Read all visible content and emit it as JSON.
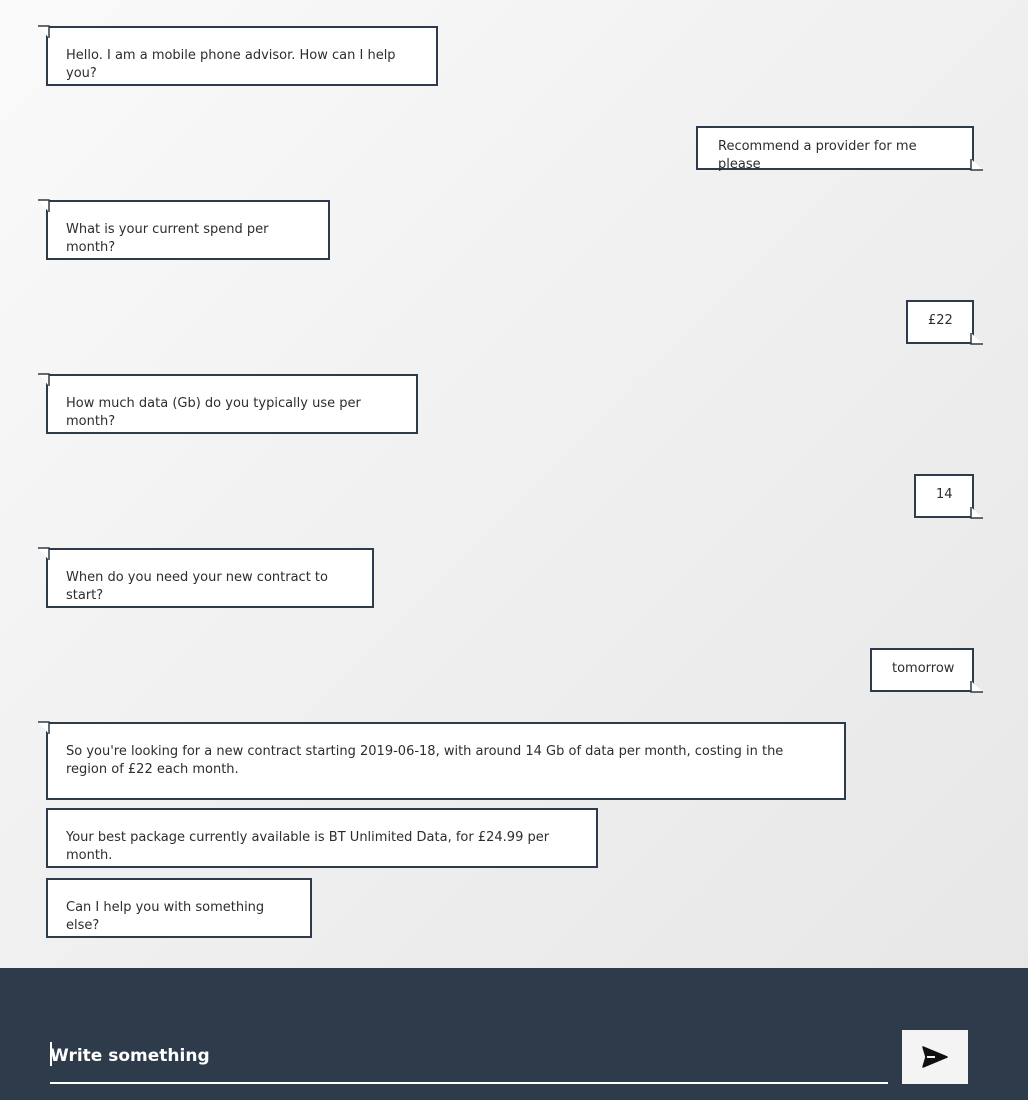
{
  "messages": [
    {
      "sender": "bot",
      "text": "Hello. I am a mobile phone advisor. How can I help you?"
    },
    {
      "sender": "user",
      "text": "Recommend a provider for me please"
    },
    {
      "sender": "bot",
      "text": "What is your current spend per month?"
    },
    {
      "sender": "user",
      "text": "£22"
    },
    {
      "sender": "bot",
      "text": "How much data (Gb) do you typically use per month?"
    },
    {
      "sender": "user",
      "text": "14"
    },
    {
      "sender": "bot",
      "text": "When do you need your new contract to start?"
    },
    {
      "sender": "user",
      "text": "tomorrow"
    },
    {
      "sender": "bot",
      "text": "So you're looking for a new contract starting 2019-06-18, with around 14 Gb of data per month, costing in the region of £22 each month."
    },
    {
      "sender": "bot",
      "text": "Your best package currently available is BT Unlimited Data, for £24.99 per month."
    },
    {
      "sender": "bot",
      "text": "Can I help you with something else?"
    }
  ],
  "composer": {
    "placeholder": "Write something",
    "send_icon": "send-icon"
  },
  "colors": {
    "composer_background": "#2e3b4b",
    "bubble_border": "#2e3b4a",
    "bubble_background": "#ffffff",
    "send_button_background": "#f4f4f4"
  }
}
